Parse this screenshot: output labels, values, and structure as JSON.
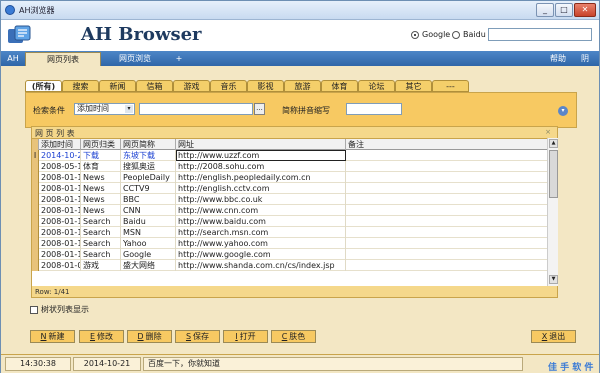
{
  "window": {
    "title": "AH浏览器",
    "controls": {
      "minimize": "_",
      "maximize": "□",
      "close": "✕"
    }
  },
  "header": {
    "brand": "AH Browser",
    "engines": [
      {
        "label": "Google",
        "selected": true
      },
      {
        "label": "Baidu",
        "selected": false
      }
    ],
    "search_value": ""
  },
  "tabs": {
    "items": [
      "AH",
      "网页列表",
      "网页浏览",
      "+"
    ],
    "active_index": 1,
    "right": [
      "帮助",
      "阴"
    ]
  },
  "categories": {
    "items": [
      "(所有)",
      "搜索",
      "新闻",
      "信箱",
      "游戏",
      "音乐",
      "影视",
      "旅游",
      "体育",
      "论坛",
      "其它",
      "---"
    ],
    "active_index": 0
  },
  "filter": {
    "label_condition": "检索条件",
    "select_value": "添加时间",
    "select_arrow": "▾",
    "input_value": "",
    "browse_btn": "...",
    "label_pinyin": "简称拼音缩写",
    "pinyin_value": "",
    "collapse_icon": "▾"
  },
  "list": {
    "title": "网 页 列 表",
    "close_glyph": "×",
    "columns": [
      "添加时间",
      "网页归类",
      "网页简称",
      "网址",
      "备注"
    ],
    "row_marker": "I",
    "rows": [
      [
        "2014-10-2",
        "下载",
        "东坡下载",
        "http://www.uzzf.com",
        ""
      ],
      [
        "2008-05-1",
        "体育",
        "搜狐奥运",
        "http://2008.sohu.com",
        ""
      ],
      [
        "2008-01-1",
        "News",
        "PeopleDaily",
        "http://english.peopledaily.com.cn",
        ""
      ],
      [
        "2008-01-1",
        "News",
        "CCTV9",
        "http://english.cctv.com",
        ""
      ],
      [
        "2008-01-1",
        "News",
        "BBC",
        "http://www.bbc.co.uk",
        ""
      ],
      [
        "2008-01-1",
        "News",
        "CNN",
        "http://www.cnn.com",
        ""
      ],
      [
        "2008-01-1",
        "Search",
        "Baidu",
        "http://www.baidu.com",
        ""
      ],
      [
        "2008-01-1",
        "Search",
        "MSN",
        "http://search.msn.com",
        ""
      ],
      [
        "2008-01-1",
        "Search",
        "Yahoo",
        "http://www.yahoo.com",
        ""
      ],
      [
        "2008-01-1",
        "Search",
        "Google",
        "http://www.google.com",
        ""
      ],
      [
        "2008-01-0",
        "游戏",
        "盛大网络",
        "http://www.shanda.com.cn/cs/index.jsp",
        ""
      ]
    ],
    "selected_row": 0,
    "row_count": "Row: 1/41",
    "scroll": {
      "up": "▲",
      "down": "▼"
    }
  },
  "tree_display": {
    "label": "树状列表显示",
    "checked": false
  },
  "actions": [
    {
      "key": "N",
      "label": "新建"
    },
    {
      "key": "E",
      "label": "修改"
    },
    {
      "key": "D",
      "label": "删除"
    },
    {
      "key": "S",
      "label": "保存"
    },
    {
      "key": "I",
      "label": "打开"
    },
    {
      "key": "C",
      "label": "肤色"
    },
    {
      "key": "X",
      "label": "退出"
    }
  ],
  "status": {
    "time": "14:30:38",
    "date": "2014-10-21",
    "message": "百度一下，你就知道",
    "footer_brand": "佳 手 软 件"
  }
}
